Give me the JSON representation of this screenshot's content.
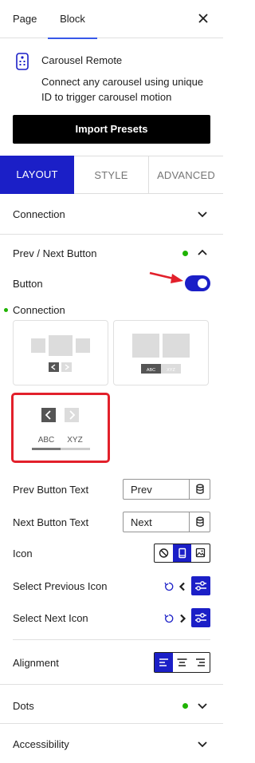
{
  "top_tabs": {
    "page": "Page",
    "block": "Block"
  },
  "block": {
    "title": "Carousel Remote",
    "description": "Connect any carousel using unique ID to trigger carousel motion",
    "import_button": "Import Presets"
  },
  "mode_tabs": {
    "layout": "LAYOUT",
    "style": "STYLE",
    "advanced": "ADVANCED"
  },
  "panels": {
    "connection": "Connection",
    "prev_next": "Prev / Next Button",
    "dots": "Dots",
    "accessibility": "Accessibility"
  },
  "prev_next": {
    "button_label": "Button",
    "button_enabled": true,
    "connection_label": "Connection",
    "preset_labels": {
      "preset2_a": "ABC",
      "preset2_b": "XYZ",
      "preset3_a": "ABC",
      "preset3_b": "XYZ"
    },
    "prev_text_label": "Prev Button Text",
    "prev_text_value": "Prev",
    "next_text_label": "Next Button Text",
    "next_text_value": "Next",
    "icon_label": "Icon",
    "select_prev_icon_label": "Select Previous Icon",
    "select_next_icon_label": "Select Next Icon",
    "alignment_label": "Alignment"
  },
  "colors": {
    "accent": "#1b1fc7",
    "status_dot": "#1fb300",
    "highlight": "#e2202b",
    "wp_blue": "#3858e9"
  }
}
